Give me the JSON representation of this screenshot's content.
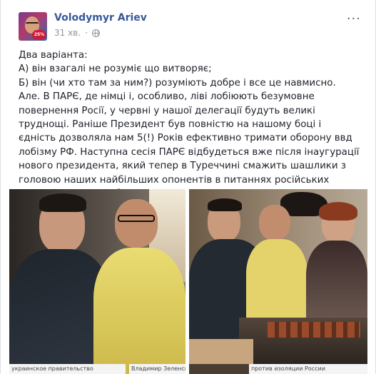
{
  "post": {
    "author": "Volodymyr Ariev",
    "time": "31 хв.",
    "avatar_badge": "25%",
    "more_label": "···",
    "paragraphs": [
      "Два варіанта:",
      "А) він взагалі не розуміє що витворяє;",
      "Б) він (чи хто там за ним?) розуміють добре і все це навмисно.",
      "Але. В ПАРЄ, де німці і, особливо, ліві лобіюють безумовне повернення Росії, у червні у нашої делегації будуть великі труднощі. Раніше Президент був повністю на нашому боці і єдність дозволяла нам 5(!) Років ефективно тримати оборону ввд лобізму РФ. Наступна сесія ПАРЄ відбудеться вже після інаугурації нового президента, який тепер в Туреччині смажить шашлики з головою наших найбільших опонентів в питаннях російських санкцій. Приїхали, б..."
    ]
  },
  "photos": {
    "captions": [
      "украинское правительство",
      "Владимир Зеленский, отдыхавший",
      "против изоляции России"
    ]
  },
  "colors": {
    "author": "#385898",
    "meta": "#90949c",
    "text": "#1d2129"
  }
}
